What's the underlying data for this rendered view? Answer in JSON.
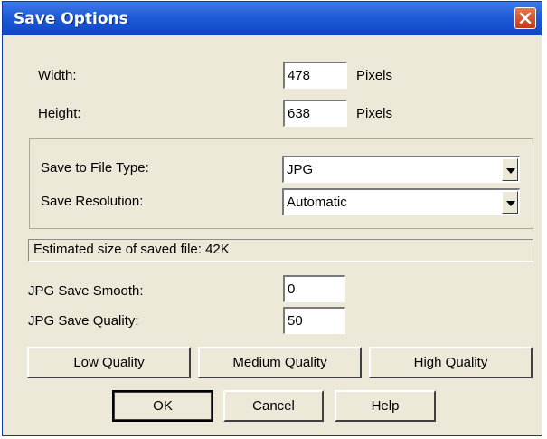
{
  "window": {
    "title": "Save Options"
  },
  "dimensions": {
    "width_label": "Width:",
    "width_value": "478",
    "width_unit": "Pixels",
    "height_label": "Height:",
    "height_value": "638",
    "height_unit": "Pixels"
  },
  "save_settings": {
    "file_type_label": "Save to File Type:",
    "file_type_value": "JPG",
    "resolution_label": "Save Resolution:",
    "resolution_value": "Automatic"
  },
  "status": {
    "estimated_size": "Estimated size of saved file: 42K"
  },
  "jpg": {
    "smooth_label": "JPG Save Smooth:",
    "smooth_value": "0",
    "quality_label": "JPG Save Quality:",
    "quality_value": "50"
  },
  "presets": {
    "low": "Low Quality",
    "medium": "Medium Quality",
    "high": "High Quality"
  },
  "actions": {
    "ok": "OK",
    "cancel": "Cancel",
    "help": "Help"
  },
  "colors": {
    "titlebar": "#1f5bd6",
    "dialog_bg": "#ece9d8",
    "close_button": "#c23b13"
  },
  "icons": {
    "close": "close-icon",
    "dropdown": "chevron-down-icon"
  }
}
